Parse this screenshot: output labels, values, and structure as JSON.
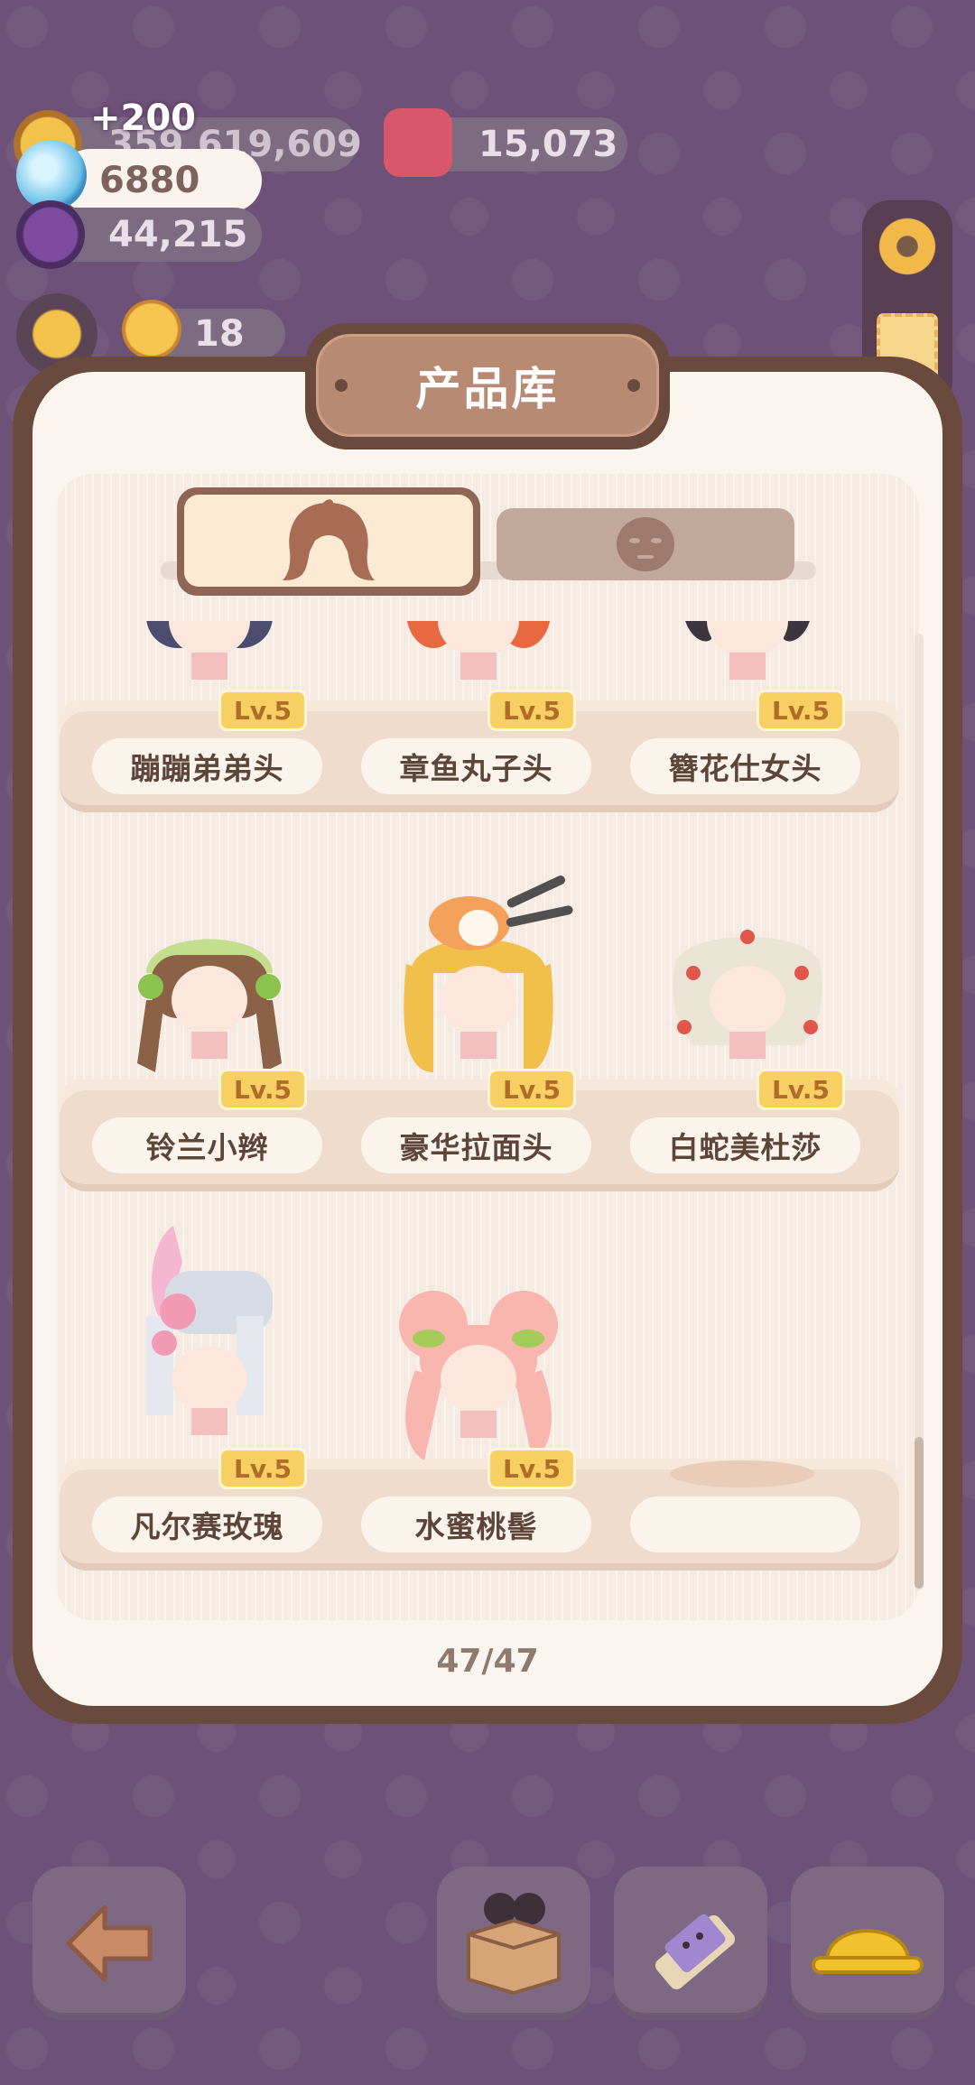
{
  "hud": {
    "coins_value": "359,619,609",
    "coins_gain": "+200",
    "gems_value": "6880",
    "grapes_value": "44,215",
    "jelly_value": "15,073",
    "chick_value": "18"
  },
  "panel": {
    "title": "产品库",
    "tabs": [
      {
        "name": "hair-tab",
        "icon": "hair-icon",
        "active": true
      },
      {
        "name": "face-tab",
        "icon": "face-mask-icon",
        "active": false
      }
    ],
    "pager": "47/47"
  },
  "items": [
    {
      "name": "蹦蹦弟弟头",
      "level": "Lv.5"
    },
    {
      "name": "章鱼丸子头",
      "level": "Lv.5"
    },
    {
      "name": "簪花仕女头",
      "level": "Lv.5"
    },
    {
      "name": "铃兰小辫",
      "level": "Lv.5"
    },
    {
      "name": "豪华拉面头",
      "level": "Lv.5"
    },
    {
      "name": "白蛇美杜莎",
      "level": "Lv.5"
    },
    {
      "name": "凡尔赛玫瑰",
      "level": "Lv.5"
    },
    {
      "name": "水蜜桃髻",
      "level": "Lv.5"
    }
  ],
  "colors": {
    "background": "#6e5178",
    "panel_frame": "#6b4a3e",
    "title_plate": "#b88a73",
    "level_badge": "#f8cf62"
  },
  "bottom_bar": [
    {
      "icon": "back-arrow-icon"
    },
    {
      "icon": "box-icon"
    },
    {
      "icon": "pencil-icon"
    },
    {
      "icon": "hard-hat-icon"
    }
  ]
}
